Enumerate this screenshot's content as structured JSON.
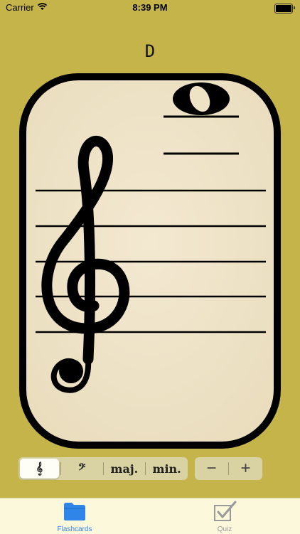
{
  "status_bar": {
    "carrier": "Carrier",
    "time": "8:39 PM",
    "icons": [
      "wifi-icon",
      "battery-icon"
    ]
  },
  "note_name": "D",
  "card": {
    "clef": "treble",
    "staff_lines": 5,
    "ledger_lines_above": 2,
    "note": "whole note on ledger line above staff",
    "colors": {
      "background": "#c4b44a",
      "card_fill": "#efe3c6",
      "card_border": "#000000"
    }
  },
  "controls": {
    "segments": [
      {
        "id": "treble",
        "icon": "treble-clef-icon",
        "label": "𝄞",
        "selected": true
      },
      {
        "id": "bass",
        "icon": "bass-clef-icon",
        "label": "𝄢",
        "selected": false
      },
      {
        "id": "major",
        "label": "maj.",
        "selected": false
      },
      {
        "id": "minor",
        "label": "min.",
        "selected": false
      }
    ],
    "stepper": {
      "minus": "−",
      "plus": "+"
    }
  },
  "tabbar": {
    "tabs": [
      {
        "label": "Flashcards",
        "icon": "folder-icon",
        "active": true,
        "color": "#2f86e8"
      },
      {
        "label": "Quiz",
        "icon": "checkbox-icon",
        "active": false,
        "color": "#9a9a9a"
      }
    ]
  }
}
